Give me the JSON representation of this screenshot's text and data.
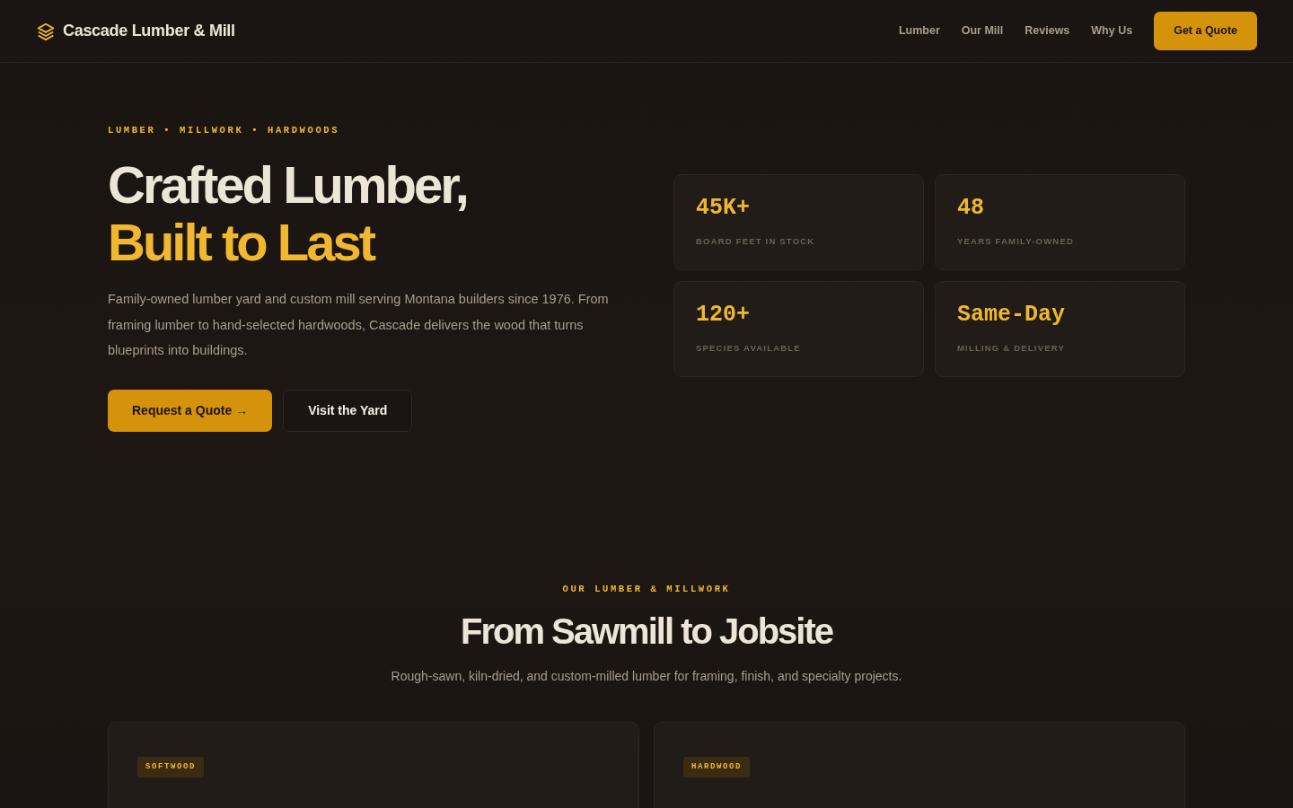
{
  "brand": {
    "name": "Cascade Lumber & Mill"
  },
  "nav": {
    "links": [
      {
        "label": "Lumber"
      },
      {
        "label": "Our Mill"
      },
      {
        "label": "Reviews"
      },
      {
        "label": "Why Us"
      }
    ],
    "cta": "Get a Quote"
  },
  "hero": {
    "eyebrow": "LUMBER • MILLWORK • HARDWOODS",
    "title_line1": "Crafted Lumber,",
    "title_line2": "Built to Last",
    "lead": "Family-owned lumber yard and custom mill serving Montana builders since 1976. From framing lumber to hand-selected hardwoods, Cascade delivers the wood that turns blueprints into buildings.",
    "buttons": [
      {
        "label": "Request a Quote →",
        "kind": "primary"
      },
      {
        "label": "Visit the Yard",
        "kind": "outline"
      }
    ],
    "stats": [
      {
        "value": "45K+",
        "label": "BOARD FEET IN STOCK"
      },
      {
        "value": "48",
        "label": "YEARS FAMILY-OWNED"
      },
      {
        "value": "120+",
        "label": "SPECIES AVAILABLE"
      },
      {
        "value": "Same-Day",
        "label": "MILLING & DELIVERY"
      }
    ]
  },
  "products": {
    "eyebrow": "OUR LUMBER & MILLWORK",
    "title": "From Sawmill to Jobsite",
    "subtitle": "Rough-sawn, kiln-dried, and custom-milled lumber for framing, finish, and specialty projects.",
    "cards": [
      {
        "tag": "SOFTWOOD"
      },
      {
        "tag": "HARDWOOD"
      }
    ]
  }
}
